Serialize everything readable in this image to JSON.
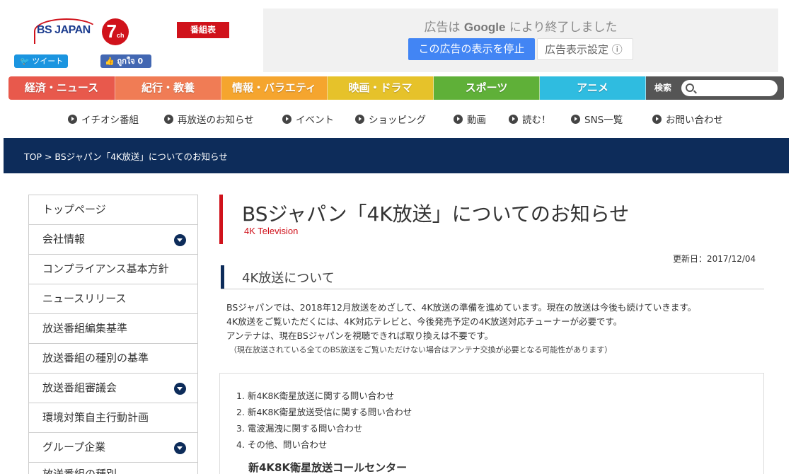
{
  "header": {
    "logo_text": "BS JAPAN",
    "logo_ch": "7",
    "logo_ch_suffix": "ch",
    "schedule_button": "番組表",
    "tweet_button": "ツイート",
    "like_button": "ถูกใจ 0"
  },
  "ad": {
    "message_prefix": "広告は",
    "message_brand": "Google",
    "message_suffix": "により終了しました",
    "stop_button": "この広告の表示を停止",
    "settings_button": "広告表示設定 ⓘ"
  },
  "genre_nav": [
    "経済・ニュース",
    "紀行・教養",
    "情報・バラエティ",
    "映画・ドラマ",
    "スポーツ",
    "アニメ"
  ],
  "search": {
    "label": "検索",
    "placeholder": ""
  },
  "sub_nav": [
    "イチオシ番組",
    "再放送のお知らせ",
    "イベント",
    "ショッピング",
    "動画",
    "読む！",
    "SNS一覧",
    "お問い合わせ"
  ],
  "breadcrumb": "TOP > BSジャパン「4K放送」についてのお知らせ",
  "sidebar": [
    {
      "label": "トップページ",
      "expandable": false
    },
    {
      "label": "会社情報",
      "expandable": true
    },
    {
      "label": "コンプライアンス基本方針",
      "expandable": false
    },
    {
      "label": "ニュースリリース",
      "expandable": false
    },
    {
      "label": "放送番組編集基準",
      "expandable": false
    },
    {
      "label": "放送番組の種別の基準",
      "expandable": false
    },
    {
      "label": "放送番組審議会",
      "expandable": true
    },
    {
      "label": "環境対策自主行動計画",
      "expandable": false
    },
    {
      "label": "グループ企業",
      "expandable": true
    }
  ],
  "sidebar_partial": "放送番組の種別",
  "main": {
    "title": "BSジャパン「4K放送」についてのお知らせ",
    "subtitle": "4K Television",
    "updated": "更新日：2017/12/04",
    "section_title": "4K放送について",
    "paragraphs": [
      "BSジャパンでは、2018年12月放送をめざして、4K放送の準備を進めています。現在の放送は今後も続けていきます。",
      "4K放送をご覧いただくには、4K対応テレビと、今後発売予定の4K放送対応チューナーが必要です。",
      "アンテナは、現在BSジャパンを視聴できれば取り換えは不要です。"
    ],
    "note": "（現在放送されている全てのBS放送をご覧いただけない場合はアンテナ交換が必要となる可能性があります）",
    "inquiry_list": [
      "1. 新4K8K衛星放送に関する問い合わせ",
      "2. 新4K8K衛星放送受信に関する問い合わせ",
      "3. 電波漏洩に関する問い合わせ",
      "4. その他、問い合わせ"
    ],
    "call_center": "新4K8K衛星放送コールセンター"
  },
  "colors": {
    "brand_red": "#d0121b",
    "navy": "#0d2c5a",
    "genre": [
      "#e8594c",
      "#f07c55",
      "#f5a52e",
      "#e6c22a",
      "#5fb038",
      "#2fbce0"
    ]
  }
}
